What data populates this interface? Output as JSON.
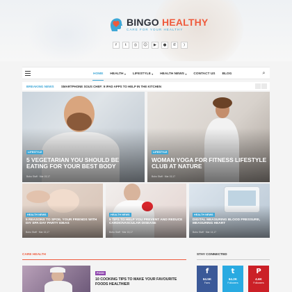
{
  "brand": {
    "name_part1": "BINGO",
    "name_part2": "HEALTHY",
    "tagline": "CARE FOR YOUR HEALTHY",
    "accent_color": "#ef5a3c",
    "blue_color": "#3fa7d6"
  },
  "header_social": [
    {
      "icon": "facebook-icon",
      "glyph": "f"
    },
    {
      "icon": "twitter-icon",
      "glyph": "t"
    },
    {
      "icon": "instagram-icon",
      "glyph": "◎"
    },
    {
      "icon": "snapchat-icon",
      "glyph": "☺"
    },
    {
      "icon": "youtube-icon",
      "glyph": "▶"
    },
    {
      "icon": "reddit-icon",
      "glyph": "●"
    },
    {
      "icon": "whatsapp-icon",
      "glyph": "✆"
    },
    {
      "icon": "rss-icon",
      "glyph": ")"
    }
  ],
  "nav": {
    "items": [
      {
        "label": "HOME",
        "dropdown": false,
        "active": true
      },
      {
        "label": "HEALTH",
        "dropdown": true,
        "active": false
      },
      {
        "label": "LIFESTYLE",
        "dropdown": true,
        "active": false
      },
      {
        "label": "HEALTH NEWS",
        "dropdown": true,
        "active": false
      },
      {
        "label": "CONTACT US",
        "dropdown": false,
        "active": false
      },
      {
        "label": "BLOG",
        "dropdown": false,
        "active": false
      }
    ]
  },
  "breaking": {
    "label": "BREAKING NEWS",
    "headline": "SMARTPHONE SOUS CHEF: 9 IPAD APPS TO HELP IN THE KITCHEN"
  },
  "featured": [
    {
      "category": "LIFESTYLE",
      "title": "5 VEGETARIAN YOU SHOULD BE EATING FOR YOUR BEST BODY",
      "meta": "Bubu Staff  ·  Mar 15,17"
    },
    {
      "category": "LIFESTYLE",
      "title": "WOMAN YOGA FOR FITNESS LIFESTYLE CLUB AT NATURE",
      "meta": "Bubu Staff  ·  Mar 15,17"
    },
    {
      "category": "HEALTH NEWS",
      "title": "5 REASONS TO SPOIL YOUR FRIENDS WITH DIY SPA DAY PARTY IDEAS",
      "meta": "Bubu Staff  ·  Mar 15,17"
    },
    {
      "category": "HEALTH NEWS",
      "title": "5 TIPS TO HELP YOU PREVENT AND REDUCE CARDIOVASCULAR DISEASE",
      "meta": "Bubu Staff  ·  Mar 15,17"
    },
    {
      "category": "HEALTH NEWS",
      "title": "DIGITAL MEASURING BLOOD PRESSURE, MEASURING HEART",
      "meta": "Bubu Staff  ·  Mar 14,17"
    }
  ],
  "care_health": {
    "heading": "CARE HEALTH",
    "post_category": "FOOD",
    "post_title": "10 COOKING TIPS TO MAKE YOUR FAVOURITE FOODS HEALTHIER"
  },
  "stay_connected": {
    "heading": "STAY CONNECTED",
    "boxes": [
      {
        "icon": "facebook-icon",
        "glyph": "f",
        "count": "64.5K",
        "label": "Fans",
        "color": "#3b5998"
      },
      {
        "icon": "twitter-icon",
        "glyph": "t",
        "count": "64.2K",
        "label": "Followers",
        "color": "#29aae1"
      },
      {
        "icon": "pinterest-icon",
        "glyph": "P",
        "count": "4.6K",
        "label": "Followers",
        "color": "#cb2027"
      }
    ]
  }
}
